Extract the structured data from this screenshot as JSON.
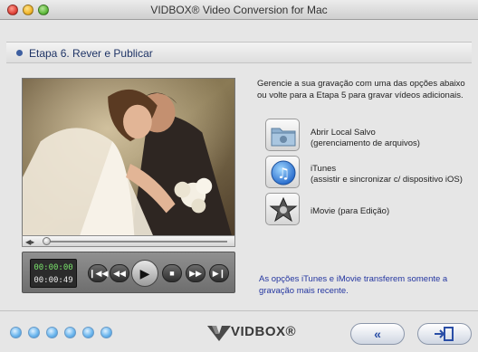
{
  "window": {
    "title": "VIDBOX® Video Conversion for Mac"
  },
  "step": {
    "title": "Etapa 6. Rever e Publicar"
  },
  "player": {
    "time_current": "00:00:00",
    "time_total": "00:00:49",
    "progress": 0,
    "buttons": [
      "skip-back",
      "rewind",
      "play",
      "stop",
      "fast-forward",
      "skip-forward"
    ]
  },
  "intro_text": "Gerencie a sua gravação com uma das opções abaixo ou volte para a Etapa 5 para gravar vídeos adicionais.",
  "options": [
    {
      "icon": "folder-icon",
      "line1": "Abrir Local Salvo",
      "line2": "(gerenciamento de arquivos)"
    },
    {
      "icon": "itunes-icon",
      "line1": "iTunes",
      "line2": "(assistir e sincronizar c/ dispositivo iOS)"
    },
    {
      "icon": "imovie-icon",
      "line1": "iMovie (para Edição)",
      "line2": ""
    }
  ],
  "note": "As opções iTunes e iMovie transferem somente a gravação mais recente.",
  "footer": {
    "logo_text": "VIDBOX®",
    "back_label": "«",
    "steps_total": 6,
    "accent": "#2a4ea6"
  }
}
